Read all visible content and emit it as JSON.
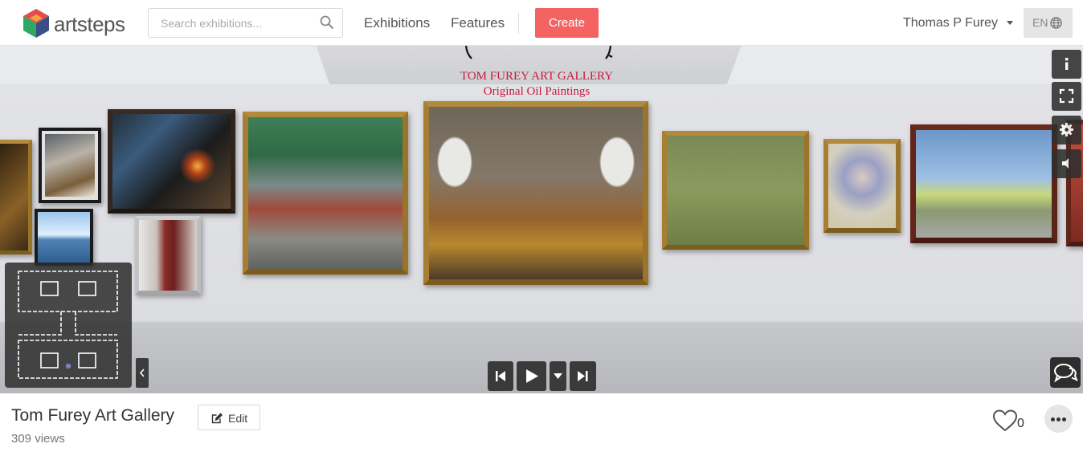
{
  "brand": {
    "name": "artsteps"
  },
  "search": {
    "placeholder": "Search exhibitions..."
  },
  "nav": {
    "exhibitions": "Exhibitions",
    "features": "Features",
    "create": "Create"
  },
  "user": {
    "name": "Thomas P Furey",
    "language": "EN"
  },
  "viewer": {
    "wall_title_line1": "TOM FUREY ART GALLERY",
    "wall_title_line2": "Original Oil Paintings"
  },
  "exhibition": {
    "title": "Tom Furey Art Gallery",
    "edit_label": "Edit",
    "views": "309 views",
    "likes": "0"
  },
  "colors": {
    "accent": "#f46262",
    "wall_title": "#c61a3d"
  }
}
